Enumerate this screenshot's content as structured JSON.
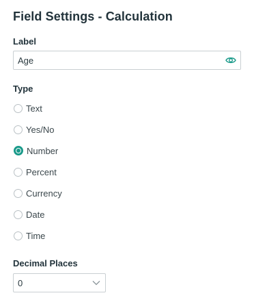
{
  "panel": {
    "title": "Field Settings - Calculation"
  },
  "label_section": {
    "heading": "Label",
    "value": "Age",
    "visibility_icon": "eye-icon"
  },
  "type_section": {
    "heading": "Type",
    "options": [
      {
        "label": "Text",
        "selected": false
      },
      {
        "label": "Yes/No",
        "selected": false
      },
      {
        "label": "Number",
        "selected": true
      },
      {
        "label": "Percent",
        "selected": false
      },
      {
        "label": "Currency",
        "selected": false
      },
      {
        "label": "Date",
        "selected": false
      },
      {
        "label": "Time",
        "selected": false
      }
    ]
  },
  "decimal_section": {
    "heading": "Decimal Places",
    "selected_value": "0",
    "dropdown_icon": "chevron-down-icon"
  },
  "colors": {
    "accent": "#1a9a8a",
    "border": "#c9cfd2",
    "heading_text": "#22333b",
    "body_text": "#3b474c"
  }
}
